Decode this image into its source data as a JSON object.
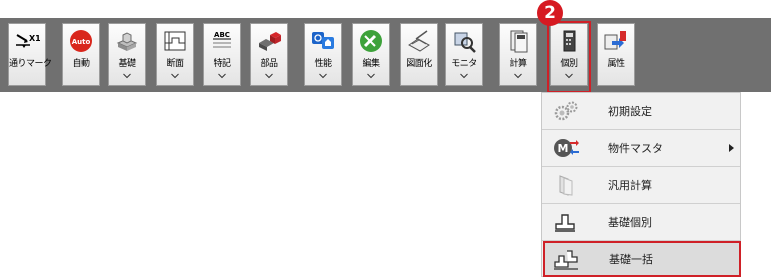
{
  "toolbar": {
    "buttons": [
      {
        "label": "通りマーク",
        "icon": "grid-line-icon",
        "extra": "X1"
      },
      {
        "label": "自動",
        "icon": "auto-icon",
        "badge": "Auto"
      },
      {
        "label": "基礎",
        "icon": "foundation-icon"
      },
      {
        "label": "断面",
        "icon": "section-icon"
      },
      {
        "label": "特記",
        "icon": "note-icon",
        "badge": "ABC"
      },
      {
        "label": "部品",
        "icon": "parts-icon"
      },
      {
        "label": "性能",
        "icon": "performance-icon"
      },
      {
        "label": "編集",
        "icon": "edit-icon"
      },
      {
        "label": "図面化",
        "icon": "drawing-icon"
      },
      {
        "label": "モニタ",
        "icon": "monitor-icon"
      },
      {
        "label": "計算",
        "icon": "calc-icon"
      },
      {
        "label": "個別",
        "icon": "individual-icon"
      },
      {
        "label": "属性",
        "icon": "attribute-icon"
      }
    ]
  },
  "callout": {
    "number": "2"
  },
  "menu": {
    "items": [
      {
        "label": "初期設定",
        "icon": "gears-icon"
      },
      {
        "label": "物件マスタ",
        "icon": "master-icon",
        "badge": "M",
        "has_submenu": true
      },
      {
        "label": "汎用計算",
        "icon": "general-calc-icon"
      },
      {
        "label": "基礎個別",
        "icon": "foundation-single-icon"
      },
      {
        "label": "基礎一括",
        "icon": "foundation-batch-icon",
        "highlighted": true
      }
    ]
  },
  "colors": {
    "toolbar_bg": "#707070",
    "highlight": "#cf2027",
    "menu_bg": "#f1f1f1"
  }
}
